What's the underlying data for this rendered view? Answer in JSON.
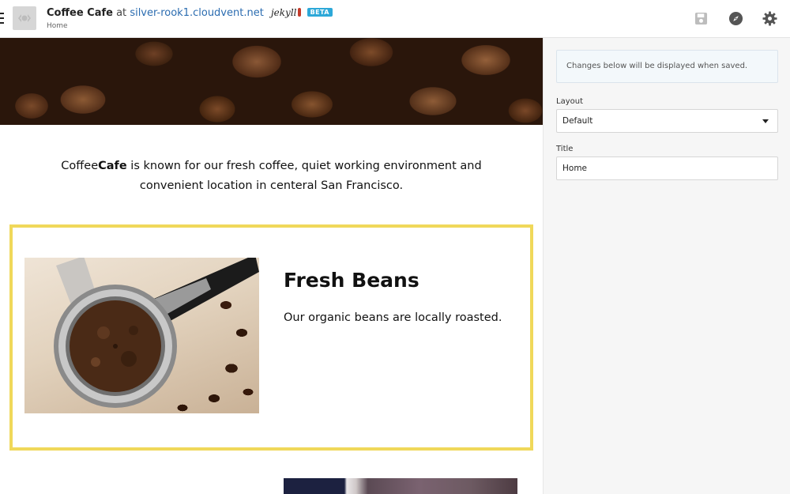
{
  "header": {
    "site_name": "Coffee Cafe",
    "at_text": "at",
    "domain": "silver-rook1.cloudvent.net",
    "generator": "jekyll",
    "badge": "BETA",
    "breadcrumb": "Home",
    "icons": {
      "menu": "hamburger-icon",
      "logo": "site-logo",
      "save": "save-icon",
      "explore": "compass-icon",
      "settings": "gear-icon"
    }
  },
  "preview": {
    "intro_brand_a": "Coffee",
    "intro_brand_b": "Cafe",
    "intro_text": " is known for our fresh coffee, quiet working environment and convenient location in centeral San Francisco.",
    "feature": {
      "title": "Fresh Beans",
      "description": "Our organic beans are locally roasted."
    },
    "colors": {
      "feature_border": "#f0d85a"
    }
  },
  "sidebar": {
    "notice": "Changes below will be displayed when saved.",
    "layout_label": "Layout",
    "layout_value": "Default",
    "title_label": "Title",
    "title_value": "Home"
  },
  "colors": {
    "accent": "#2b6cb0",
    "beta_badge": "#2da8d8"
  }
}
